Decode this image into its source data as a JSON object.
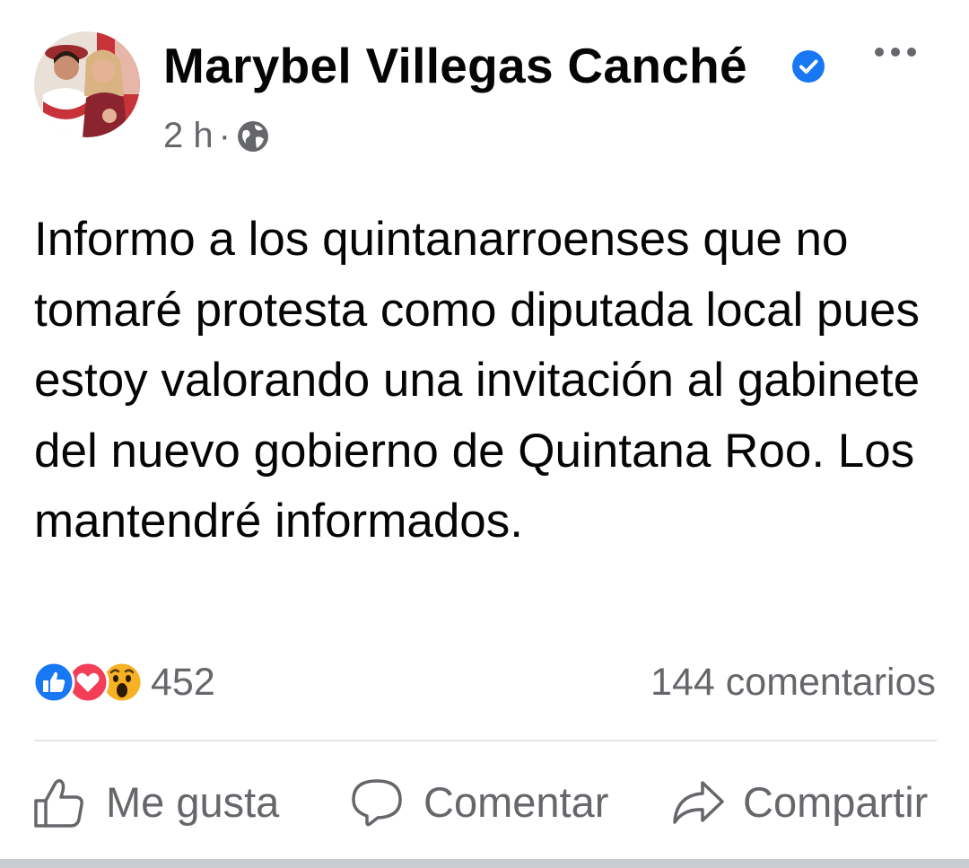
{
  "post": {
    "author": {
      "name": "Marybel Villegas Canché",
      "verified": true
    },
    "timestamp": "2 h",
    "separator": "·",
    "audience_icon": "globe-icon",
    "text": "Informo a los quintanarroenses que no tomaré protesta como diputada local pues estoy valorando una invitación al gabinete del nuevo gobierno de Quintana Roo. Los mantendré informados.",
    "reactions": {
      "icons": [
        "like-reaction-icon",
        "love-reaction-icon",
        "wow-reaction-icon"
      ],
      "count": "452"
    },
    "comments_count": "144 comentarios"
  },
  "actions": {
    "like_label": "Me gusta",
    "comment_label": "Comentar",
    "share_label": "Compartir"
  },
  "colors": {
    "text": "#050505",
    "secondary": "#65676b",
    "verified": "#1877f2",
    "like": "#1877f2",
    "love": "#f33e58",
    "wow": "#f7b125",
    "divider": "#e4e6eb"
  }
}
